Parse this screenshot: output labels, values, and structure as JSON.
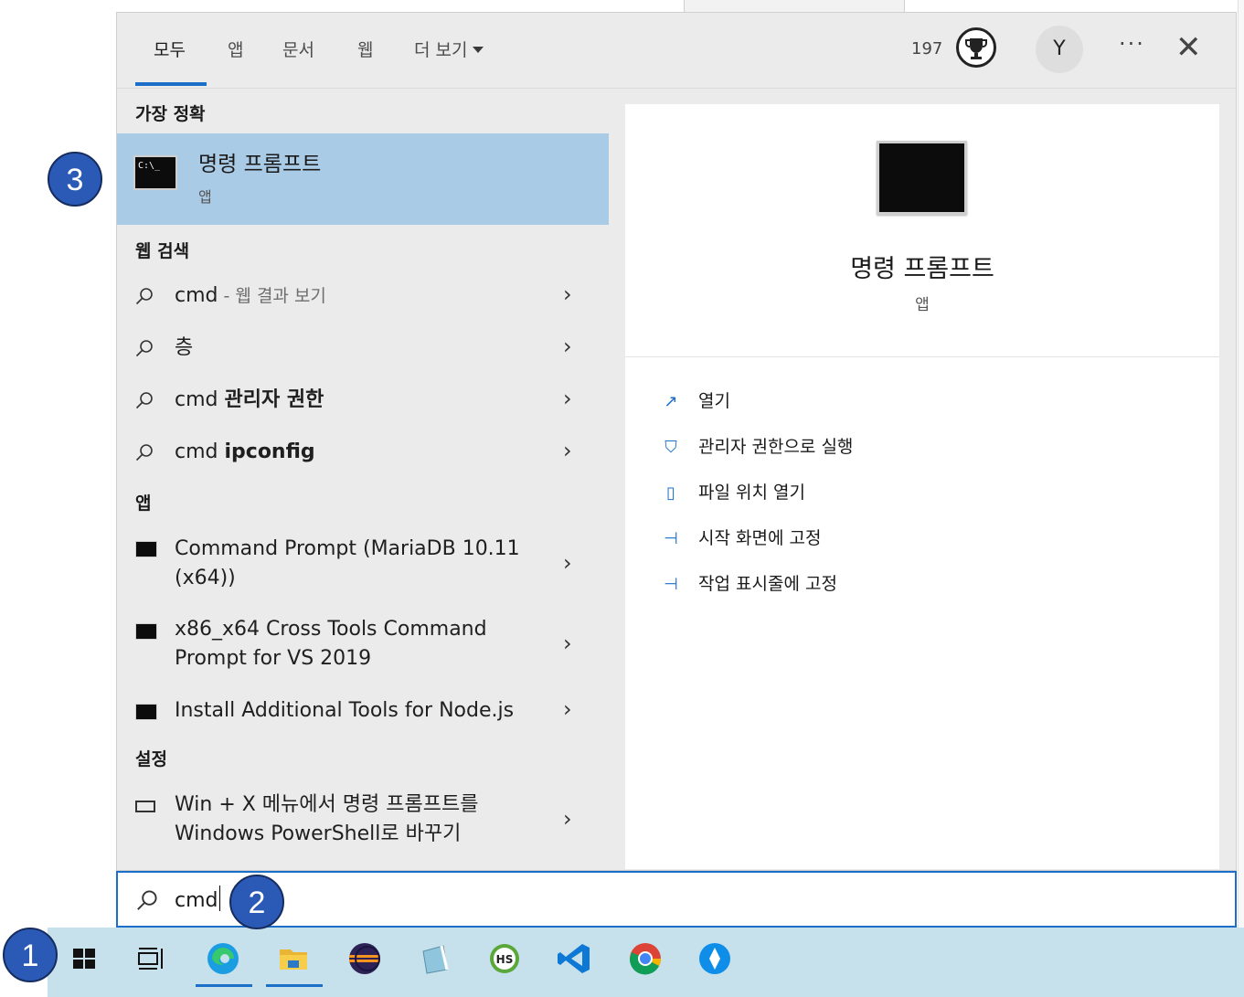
{
  "tabs": [
    {
      "label": "모두",
      "active": true
    },
    {
      "label": "앱"
    },
    {
      "label": "문서"
    },
    {
      "label": "웹"
    },
    {
      "label": "더 보기"
    }
  ],
  "header": {
    "points": "197",
    "avatar_initial": "Y",
    "more_label": "···",
    "close_label": "✕"
  },
  "best_match": {
    "section": "가장 정확",
    "title": "명령 프롬프트",
    "subtitle": "앱",
    "icon_text": "C:\\_"
  },
  "web_search": {
    "section": "웹 검색",
    "items": [
      {
        "prefix": "cmd",
        "suffix": " - 웹 결과 보기"
      },
      {
        "prefix": "층",
        "suffix": ""
      },
      {
        "prefix": "cmd ",
        "suffix": "관리자 권한"
      },
      {
        "prefix": "cmd ",
        "suffix": "ipconfig"
      }
    ]
  },
  "apps": {
    "section": "앱",
    "items": [
      {
        "line1": "Command Prompt (MariaDB 10.11",
        "line2": "(x64))"
      },
      {
        "line1": "x86_x64 Cross Tools Command",
        "line2": "Prompt for VS 2019"
      },
      {
        "line1": "Install Additional Tools for Node.js"
      }
    ]
  },
  "settings": {
    "section": "설정",
    "items": [
      {
        "line1": "Win + X 메뉴에서 명령 프롬프트를",
        "line2": "Windows PowerShell로 바꾸기"
      }
    ]
  },
  "detail": {
    "title": "명령 프롬프트",
    "subtitle": "앱",
    "actions": [
      "열기",
      "관리자 권한으로 실행",
      "파일 위치 열기",
      "시작 화면에 고정",
      "작업 표시줄에 고정"
    ]
  },
  "search": {
    "value": "cmd"
  },
  "taskbar_icons": [
    "windows-start-icon",
    "task-view-icon",
    "edge-icon",
    "file-explorer-icon",
    "eclipse-icon",
    "notepad-icon",
    "heidisql-icon",
    "vscode-icon",
    "chrome-icon",
    "teamviewer-icon"
  ],
  "steps": [
    "1",
    "2",
    "3"
  ],
  "colors": {
    "accent": "#1c6fc9",
    "selection": "#aacbe6",
    "taskbar": "#c6e0ec",
    "badge": "#2a5ab6"
  }
}
